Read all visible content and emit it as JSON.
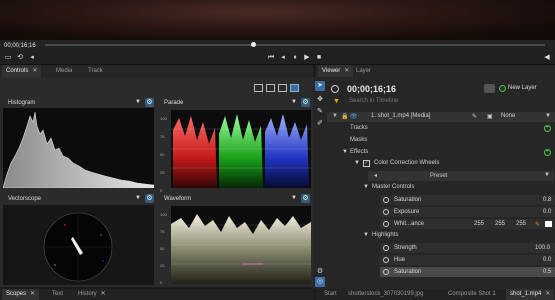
{
  "preview": {
    "timecode": "00;00;16;16"
  },
  "left_tabs": [
    {
      "label": "Controls",
      "close": "✕"
    },
    {
      "label": "Media"
    },
    {
      "label": "Track"
    }
  ],
  "scopes": {
    "histogram": {
      "title": "Histogram"
    },
    "parade": {
      "title": "Parade",
      "ticks": [
        "100",
        "75",
        "50",
        "25",
        "0"
      ]
    },
    "vectorscope": {
      "title": "Vectorscope"
    },
    "waveform": {
      "title": "Waveform",
      "ticks": [
        "100",
        "75",
        "50",
        "25",
        "0"
      ]
    }
  },
  "bottom_tabs": [
    {
      "label": "Scopes",
      "close": "✕"
    },
    {
      "label": "Text"
    },
    {
      "label": "History",
      "close": "✕"
    }
  ],
  "right_tabs": [
    {
      "label": "Viewer",
      "close": "✕"
    },
    {
      "label": "Layer"
    }
  ],
  "viewer": {
    "timecode": "00;00;16;16",
    "new_layer_label": "New Layer",
    "search_placeholder": "Search in Timeline",
    "layer_name": "1. shot_1.mp4 [Media]",
    "blend_mode": "None",
    "tracks_label": "Tracks",
    "masks_label": "Masks",
    "effects_label": "Effects",
    "effect_name": "Color Correction Wheels",
    "preset_label": "Preset",
    "master_controls_label": "Master Controls",
    "saturation_label": "Saturation",
    "saturation_value": "0.8",
    "exposure_label": "Exposure",
    "exposure_value": "0.0",
    "white_balance_label": "Whit...ance",
    "white_balance_values": [
      "255",
      "255",
      "255"
    ],
    "highlights_label": "Highlights",
    "strength_label": "Strength",
    "strength_value": "100.0",
    "hue_label": "Hue",
    "hue_value": "0.0",
    "hl_saturation_label": "Saturation",
    "hl_saturation_value": "0.5"
  },
  "right_bottom_tabs": [
    {
      "label": "Start"
    },
    {
      "label": "shutterstock_307030199.jpg"
    },
    {
      "label": "Composite Shot 1"
    },
    {
      "label": "shot_1.mp4",
      "close": "✕"
    }
  ]
}
